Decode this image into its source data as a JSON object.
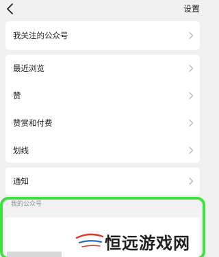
{
  "topbar": {
    "back_icon": "chevron-left-icon",
    "title": "设置"
  },
  "menu": {
    "followed": "我关注的公众号",
    "items": [
      "最近浏览",
      "赞",
      "赞赏和付费",
      "划线"
    ],
    "notify": "通知"
  },
  "my_accounts": {
    "section_label": "我的公众号"
  },
  "watermark": {
    "text": "恒远游戏网"
  },
  "colors": {
    "highlight_border": "#3ee23e",
    "background": "#f0f0f0"
  }
}
